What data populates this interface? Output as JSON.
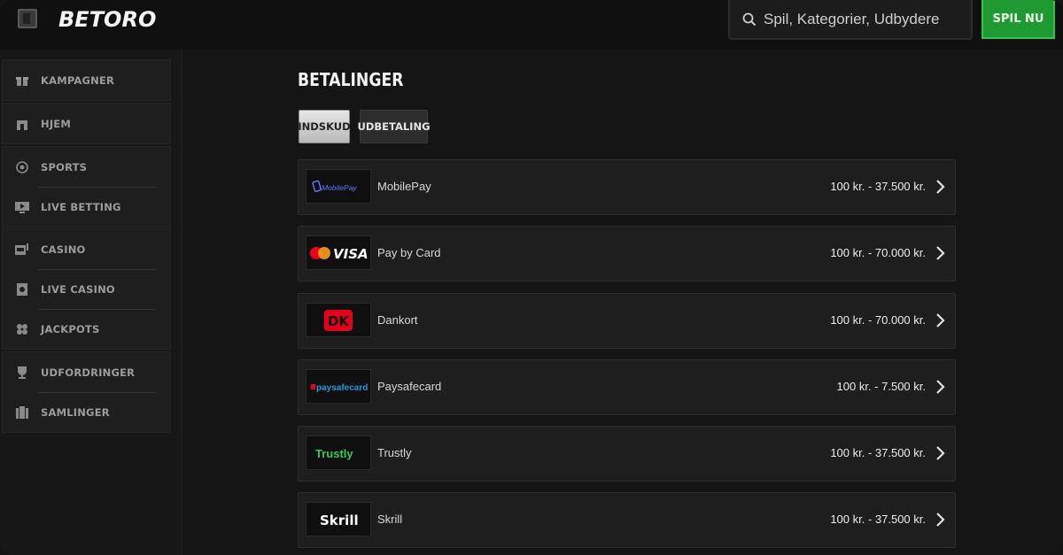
{
  "header": {
    "logo_text": "BETORO",
    "search_placeholder": "Spil, Kategorier, Udbydere",
    "play_button": "SPIL NU"
  },
  "sidebar": {
    "groups": [
      [
        {
          "label": "KAMPAGNER",
          "icon": "gift-icon"
        }
      ],
      [
        {
          "label": "HJEM",
          "icon": "home-icon"
        }
      ],
      [
        {
          "label": "SPORTS",
          "icon": "soccer-ball-icon"
        },
        {
          "label": "LIVE BETTING",
          "icon": "live-screen-icon"
        }
      ],
      [
        {
          "label": "CASINO",
          "icon": "slot-machine-icon"
        },
        {
          "label": "LIVE CASINO",
          "icon": "live-dealer-icon"
        },
        {
          "label": "JACKPOTS",
          "icon": "clover-icon"
        }
      ],
      [
        {
          "label": "UDFORDRINGER",
          "icon": "trophy-icon"
        },
        {
          "label": "SAMLINGER",
          "icon": "collection-icon"
        }
      ]
    ]
  },
  "main": {
    "title": "BETALINGER",
    "tabs": [
      {
        "label": "INDSKUD",
        "active": true
      },
      {
        "label": "UDBETALING",
        "active": false
      }
    ],
    "payments": [
      {
        "name": "MobilePay",
        "limit": "100 kr. - 37.500 kr.",
        "logo_text": "MobilePay",
        "logo_color": "#5a78ff"
      },
      {
        "name": "Pay by Card",
        "limit": "100 kr. - 70.000 kr.",
        "logo_text": "VISA",
        "logo_color": "#ffffff"
      },
      {
        "name": "Dankort",
        "limit": "100 kr. - 70.000 kr.",
        "logo_text": "DK",
        "logo_color": "#e3001b"
      },
      {
        "name": "Paysafecard",
        "limit": "100 kr. - 7.500 kr.",
        "logo_text": "paysafecard",
        "logo_color": "#1e9bd7"
      },
      {
        "name": "Trustly",
        "limit": "100 kr. - 37.500 kr.",
        "logo_text": "Trustly",
        "logo_color": "#2ecc5c"
      },
      {
        "name": "Skrill",
        "limit": "100 kr. - 37.500 kr.",
        "logo_text": "Skrill",
        "logo_color": "#ffffff"
      }
    ]
  },
  "colors": {
    "accent_green": "#1f9a32",
    "background": "#151515",
    "row_background": "#1e1e1e"
  }
}
